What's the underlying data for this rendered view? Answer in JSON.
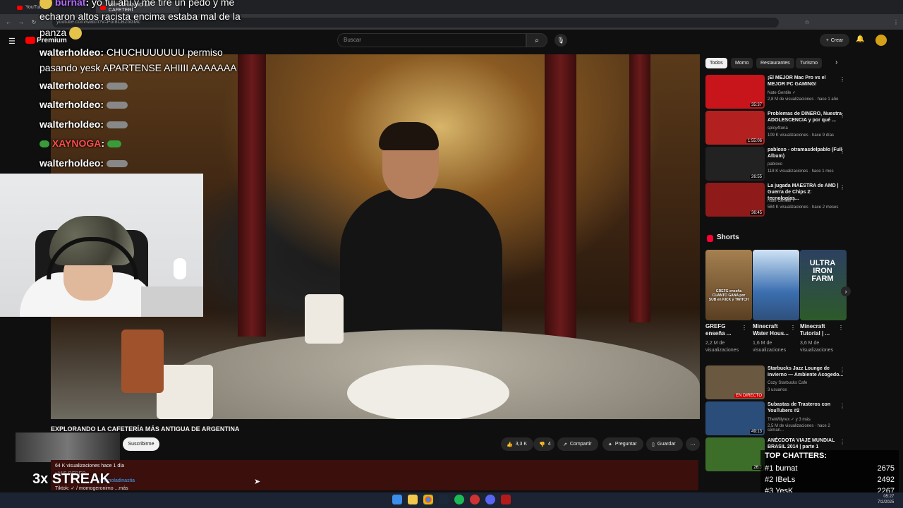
{
  "browser": {
    "tabs": [
      {
        "label": "YouTube"
      },
      {
        "label": "EXPLORANDO LA CAFETERÍ"
      }
    ],
    "url": "youtube.com/watch?v=Por8CB25GMc"
  },
  "header": {
    "logo": "Premium",
    "search_placeholder": "Buscar",
    "create_label": "Crear"
  },
  "chat": [
    {
      "user": "burnat",
      "text": "yo fui ahi y me tire un pedo y me",
      "color": "#b36bff"
    },
    {
      "user": "",
      "text": "echaron altos racista encima estaba mal de la"
    },
    {
      "user": "",
      "text": "panza"
    },
    {
      "user": "walterholdeo",
      "text": "CHUCHUUUUUU permiso"
    },
    {
      "user": "",
      "text": "pasando yesk APARTENSE AHIIII AAAAAAA"
    },
    {
      "user": "walterholdeo",
      "text": ""
    },
    {
      "user": "walterholdeo",
      "text": ""
    },
    {
      "user": "walterholdeo",
      "text": ""
    },
    {
      "user": "XAYNOGA",
      "text": "",
      "color": "#ff4d4d"
    },
    {
      "user": "walterholdeo",
      "text": ""
    }
  ],
  "video": {
    "title": "EXPLORANDO LA CAFETERÍA MÁS ANTIGUA DE ARGENTINA",
    "subscribe": "Suscribirme",
    "likes": "3,3 K",
    "dislikes": "4",
    "share": "Compartir",
    "ask": "Preguntar",
    "save": "Guardar",
    "views_line": "64 K visualizaciones  hace 1 día",
    "desc_hidden": "• MIS REDES:",
    "desc_link": "/momoladinastia",
    "desc_tiktok": "Tiktok:  ✓ / momogeronimo   ...más"
  },
  "streak": "3x STREAK",
  "chips": [
    "Todos",
    "Momo",
    "Restaurantes",
    "Turismo"
  ],
  "recs": [
    {
      "title": "¡El MEJOR Mac Pro vs el MEJOR PC GAMING!",
      "channel": "Nate Gentile ✓",
      "meta": "2,8 M de visualizaciones · hace 1 año",
      "duration": "35:37",
      "color": "#c7151b"
    },
    {
      "title": "Problemas de DINERO, Nuestra ADOLESCENCIA y por qué ...",
      "channel": "spicy4tuna",
      "meta": "109 K visualizaciones · hace 9 días",
      "duration": "1:55:06",
      "color": "#b32020"
    },
    {
      "title": "pabloxo - otramasdelpablo (Full Album)",
      "channel": "pabloxo",
      "meta": "118 K visualizaciones · hace 1 mes",
      "duration": "26:55",
      "color": "#222"
    },
    {
      "title": "La jugada MAESTRA de AMD | Guerra de Chips 2: tecnologías...",
      "channel": "Nate Gentile ✓",
      "meta": "584 K visualizaciones · hace 2 meses",
      "duration": "36:45",
      "color": "#8e1a1a"
    }
  ],
  "shorts_label": "Shorts",
  "shorts": [
    {
      "title": "GREFG enseña ...",
      "views": "2,2 M de visualizaciones",
      "thumb_text": "GREFG enseña CUANTO GANA por SUB en KICK y TWITCH",
      "color": "#8a6b3e"
    },
    {
      "title": "Minecraft Water Hous...",
      "views": "1,6 M de visualizaciones",
      "thumb_text": "",
      "color": "#3b6fb0"
    },
    {
      "title": "Minecraft Tutorial | ...",
      "views": "3,6 M de visualizaciones",
      "thumb_text": "ULTRA IRON FARM",
      "color": "#2d5a2a"
    }
  ],
  "recs2": [
    {
      "title": "Starbucks Jazz Lounge de Invierno — Ambiente Acogedo...",
      "channel": "Cozy Starbucks Cafe",
      "meta": "3 usuarios",
      "badge": "EN DIRECTO",
      "color": "#6b5840"
    },
    {
      "title": "Subastas de Trasteros con YouTubers #2",
      "channel": "TheWillyrex ✓ y 3 más",
      "meta": "2,5 M de visualizaciones · hace 2 seman...",
      "duration": "49:13",
      "color": "#2a4d7a"
    },
    {
      "title": "ANÉCDOTA VIAJE MUNDIAL BRASIL 2014 | parte 1",
      "channel": "",
      "meta": "",
      "duration": "26:3",
      "color": "#3c6e2a"
    }
  ],
  "top_chatters": {
    "title": "TOP CHATTERS:",
    "rows": [
      {
        "name": "#1 burnat",
        "score": "2675"
      },
      {
        "name": "#2 IBeLs",
        "score": "2492"
      },
      {
        "name": "#3 YesK",
        "score": "2267"
      }
    ]
  },
  "taskbar_time": "05:27",
  "taskbar_date": "7/2/2025"
}
